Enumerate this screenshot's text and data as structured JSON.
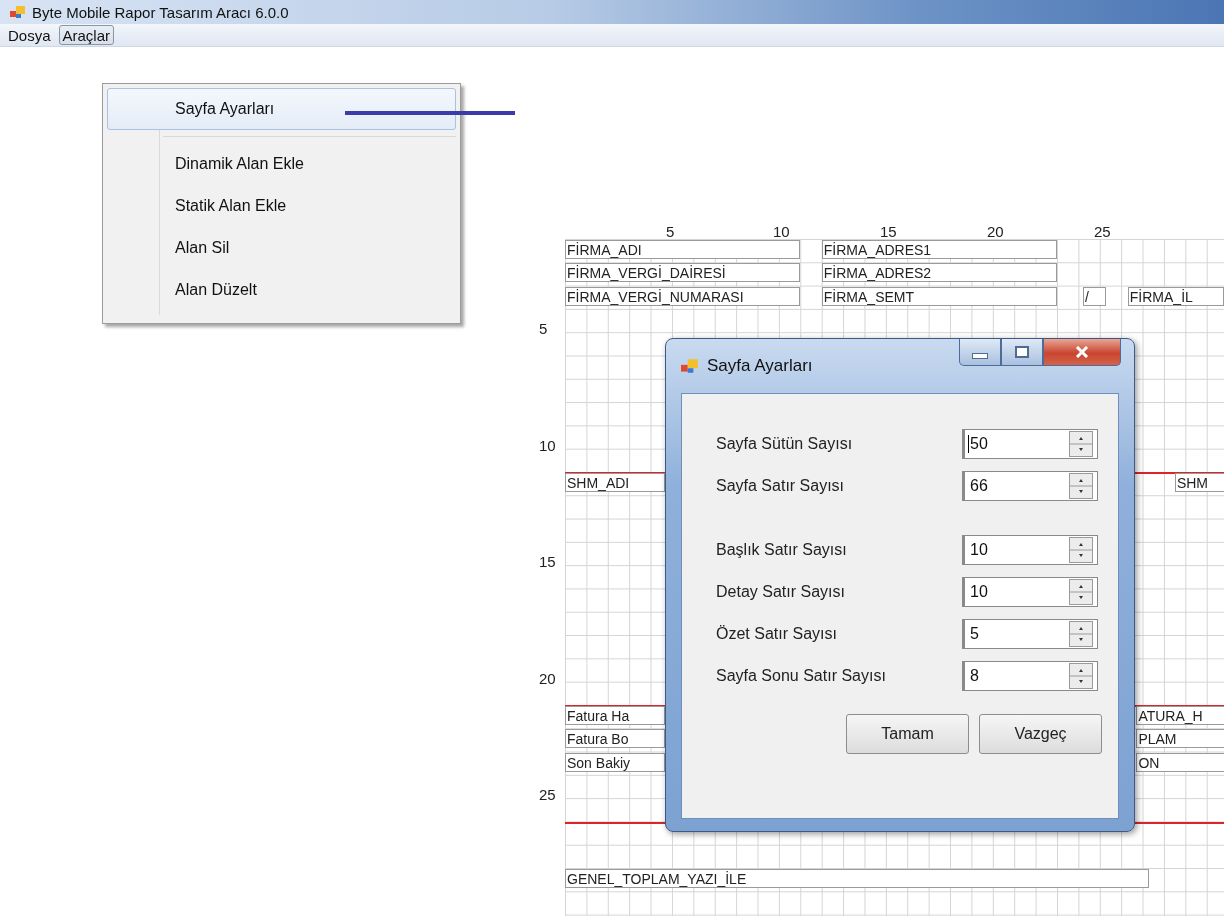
{
  "window": {
    "title": "Byte Mobile Rapor Tasarım Aracı 6.0.0"
  },
  "menu_bar": [
    {
      "label": "Dosya",
      "selected": false
    },
    {
      "label": "Araçlar",
      "selected": true
    }
  ],
  "dropdown": {
    "items": [
      {
        "kind": "item",
        "label": "Sayfa Ayarları",
        "selected": true
      },
      {
        "kind": "separator"
      },
      {
        "kind": "item",
        "label": "Dinamik Alan Ekle",
        "selected": false
      },
      {
        "kind": "item",
        "label": "Statik Alan Ekle",
        "selected": false
      },
      {
        "kind": "item",
        "label": "Alan Sil",
        "selected": false
      },
      {
        "kind": "item",
        "label": "Alan Düzelt",
        "selected": false
      }
    ]
  },
  "designer": {
    "column_ruler": [
      "5",
      "10",
      "15",
      "20",
      "25"
    ],
    "row_ruler": [
      "5",
      "10",
      "15",
      "20",
      "25"
    ],
    "fields": [
      {
        "text": "FİRMA_ADI"
      },
      {
        "text": "FİRMA_ADRES1"
      },
      {
        "text": "FİRMA_VERGİ_DAİRESİ"
      },
      {
        "text": "FİRMA_ADRES2"
      },
      {
        "text": "FİRMA_VERGİ_NUMARASI"
      },
      {
        "text": "FİRMA_SEMT"
      },
      {
        "text": "/"
      },
      {
        "text": "FİRMA_İL"
      },
      {
        "text": "SHM_ADI"
      },
      {
        "text": "SHM"
      },
      {
        "text": "Fatura Ha"
      },
      {
        "text": "Fatura Bo"
      },
      {
        "text": "Son Bakiy"
      },
      {
        "text": "ATURA_H"
      },
      {
        "text": "PLAM"
      },
      {
        "text": "ON"
      },
      {
        "text": "GENEL_TOPLAM_YAZI_İLE"
      }
    ]
  },
  "dialog": {
    "title": "Sayfa Ayarları",
    "settings": [
      {
        "label": "Sayfa Sütün Sayısı",
        "value": "50",
        "focused": true
      },
      {
        "label": "Sayfa Satır Sayısı",
        "value": "66",
        "focused": false
      },
      {
        "label": "Başlık Satır Sayısı",
        "value": "10",
        "focused": false
      },
      {
        "label": "Detay Satır Sayısı",
        "value": "10",
        "focused": false
      },
      {
        "label": "Özet Satır Sayısı",
        "value": "5",
        "focused": false
      },
      {
        "label": "Sayfa Sonu Satır Sayısı",
        "value": "8",
        "focused": false
      }
    ],
    "buttons": [
      "Tamam",
      "Vazgeç"
    ]
  }
}
